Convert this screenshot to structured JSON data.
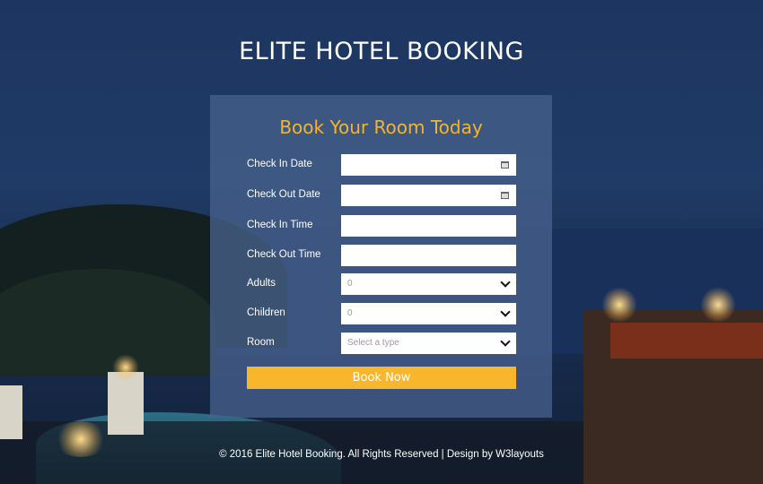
{
  "page": {
    "title": "ELITE HOTEL BOOKING"
  },
  "form": {
    "heading": "Book Your Room Today",
    "fields": [
      {
        "label": "Check In Date",
        "value": "",
        "type": "date"
      },
      {
        "label": "Check Out Date",
        "value": "",
        "type": "date"
      },
      {
        "label": "Check In Time",
        "value": "",
        "type": "text"
      },
      {
        "label": "Check Out Time",
        "value": "",
        "type": "text"
      },
      {
        "label": "Adults",
        "value": "0",
        "type": "select"
      },
      {
        "label": "Children",
        "value": "0",
        "type": "select"
      },
      {
        "label": "Room",
        "value": "Select a type",
        "type": "select"
      }
    ],
    "submit_label": "Book Now"
  },
  "footer": {
    "text": "© 2016 Elite Hotel Booking. All Rights Reserved | Design by W3layouts"
  },
  "colors": {
    "accent": "#f7b62c",
    "card": "#46608c",
    "background": "#1f3b66"
  },
  "icons": {
    "date": "calendar-icon",
    "select": "chevron-down-icon"
  }
}
